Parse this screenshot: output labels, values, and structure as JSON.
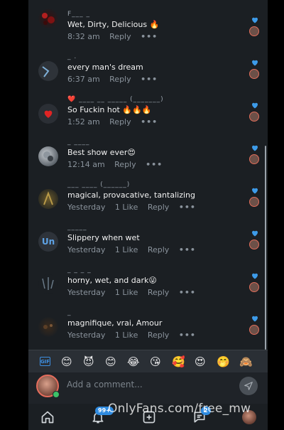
{
  "comments": [
    {
      "author": "F___ _ ",
      "text": "Wet, Dirty, Delicious 🔥",
      "time": "8:32 am",
      "likes": "",
      "reply": "Reply",
      "more": "•••"
    },
    {
      "author": "_ .",
      "text": "every man's dream",
      "time": "6:37 am",
      "likes": "",
      "reply": "Reply",
      "more": "•••"
    },
    {
      "author": "❤️ ____ __ _____ (_______)",
      "text": "So Fuckin hot 🔥🔥🔥",
      "time": "1:52 am",
      "likes": "",
      "reply": "Reply",
      "more": "•••"
    },
    {
      "author": "_ ____",
      "text": "Best show ever😍",
      "time": "12:14 am",
      "likes": "",
      "reply": "Reply",
      "more": "•••"
    },
    {
      "author": "___ ____ (______)",
      "text": "magical, provacative, tantalizing",
      "time": "Yesterday",
      "likes": "1 Like",
      "reply": "Reply",
      "more": "•••"
    },
    {
      "author": "_____",
      "avatar_initials": "Un",
      "text": "Slippery when wet",
      "time": "Yesterday",
      "likes": "1 Like",
      "reply": "Reply",
      "more": "•••"
    },
    {
      "author": "_ _ _ _",
      "text": "horny, wet, and dark😜",
      "time": "Yesterday",
      "likes": "1 Like",
      "reply": "Reply",
      "more": "•••"
    },
    {
      "author": "_",
      "text": "magnifique, vrai, Amour",
      "time": "Yesterday",
      "likes": "1 Like",
      "reply": "Reply",
      "more": "•••"
    }
  ],
  "emoji_bar": {
    "gif_label": "GIF",
    "emojis": [
      "😊",
      "😈",
      "😊",
      "😂",
      "😘",
      "🥰",
      "😍",
      "🤭",
      "🙈"
    ]
  },
  "composer": {
    "placeholder": "Add a comment..."
  },
  "nav": {
    "notifications_badge": "99+",
    "messages_badge": "2"
  },
  "watermark": "OnlyFans.com/free_mw",
  "colors": {
    "heart": "#3d9be9",
    "accent": "#2f8be0",
    "background": "#1b1f23"
  }
}
